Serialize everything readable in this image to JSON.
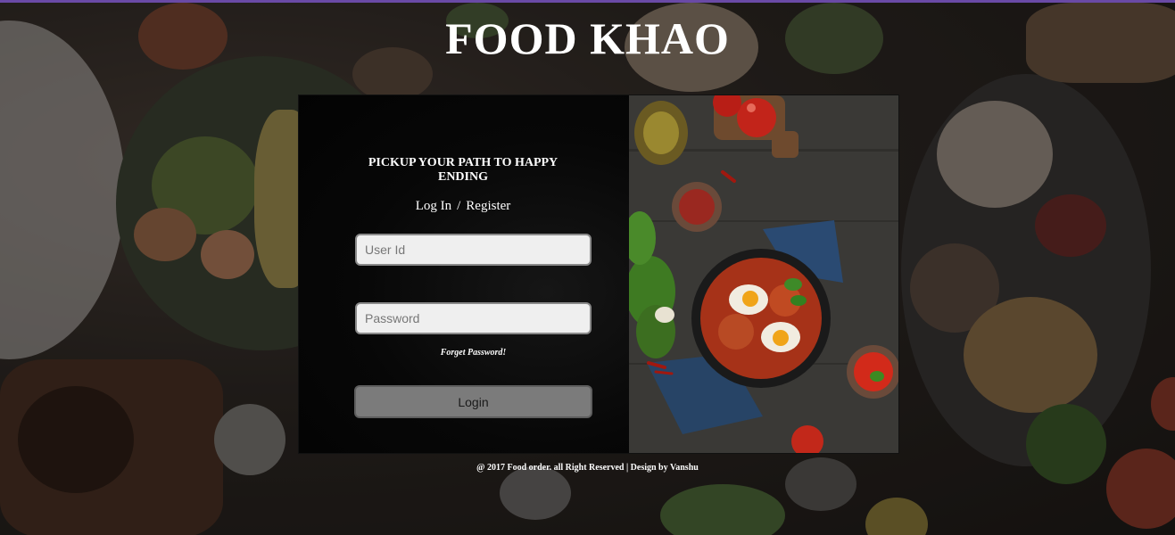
{
  "site": {
    "title": "FOOD KHAO"
  },
  "login": {
    "tagline": "PICKUP YOUR PATH TO HAPPY ENDING",
    "login_link": "Log In",
    "separator": "/",
    "register_link": "Register",
    "user_placeholder": "User Id",
    "user_value": "",
    "password_placeholder": "Password",
    "password_value": "",
    "forget_password": "Forget Password!",
    "login_button": "Login"
  },
  "footer": {
    "text": "@ 2017 Food order. all Right Reserved | Design by Vanshu"
  },
  "colors": {
    "accent_strip": "#6a4aa6",
    "button_bg": "#7b7b7b",
    "card_bg": "#000000"
  },
  "images": {
    "background": "food-table-photo",
    "card_side": "shakshuka-skillet-photo"
  }
}
